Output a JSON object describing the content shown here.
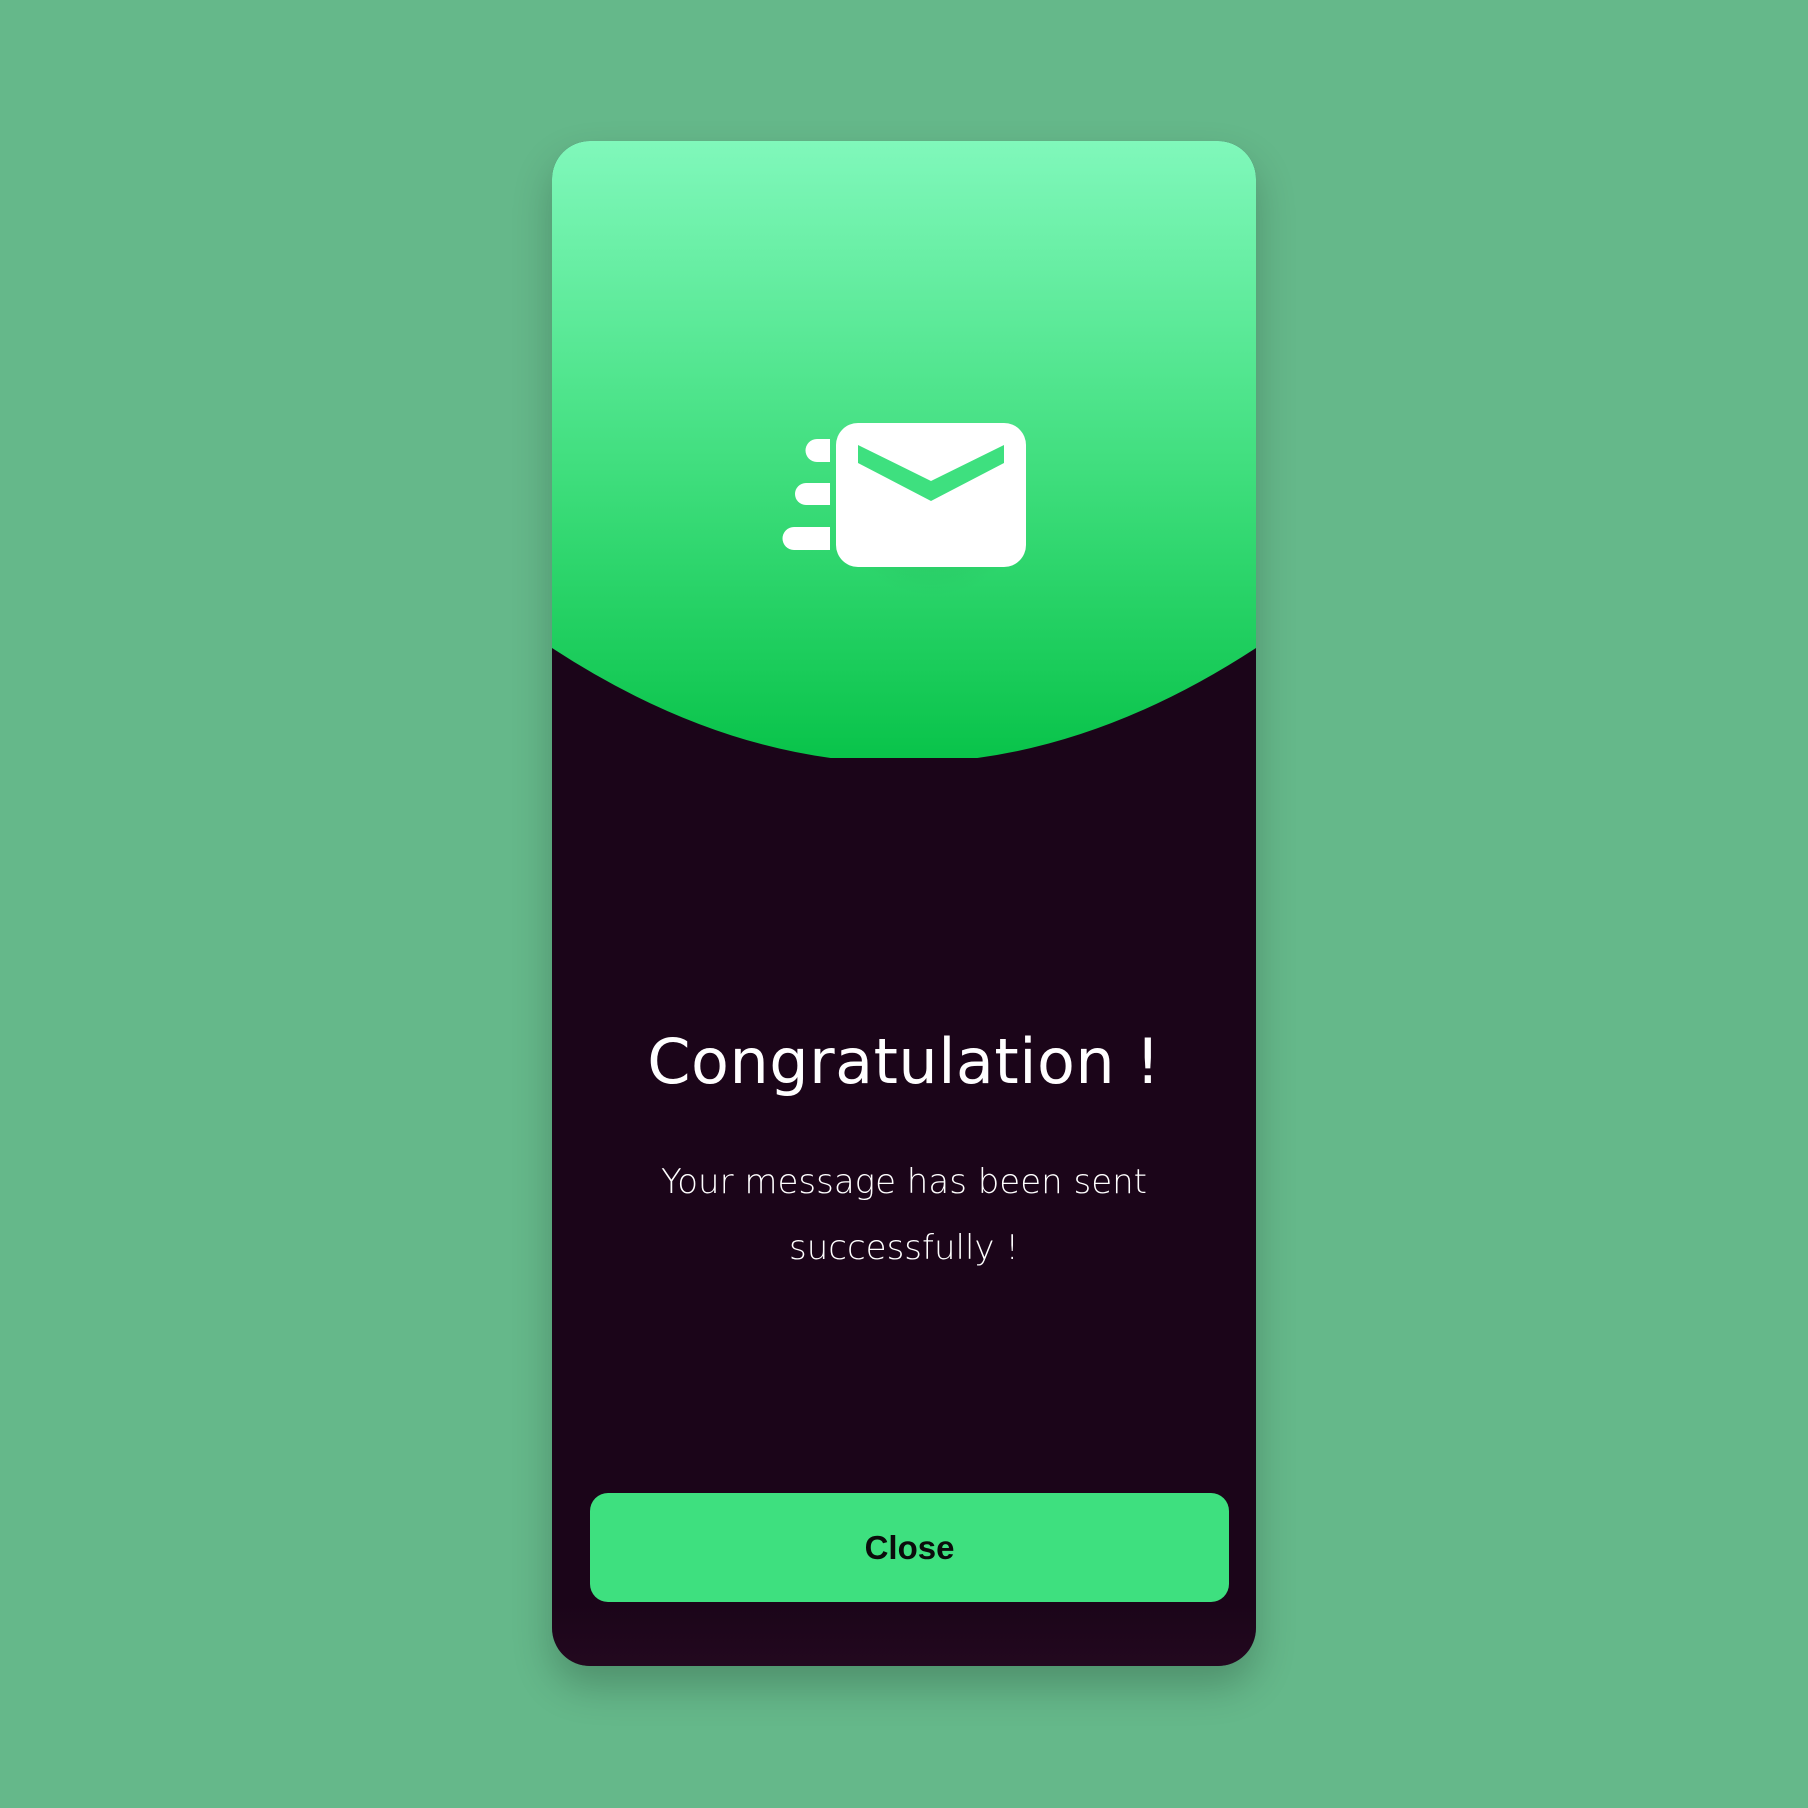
{
  "dialog": {
    "title": "Congratulation !",
    "message": "Your message has been sent successfully !",
    "close_label": "Close"
  },
  "icons": {
    "hero": "sent-mail-icon"
  },
  "colors": {
    "page_background": "#65b88a",
    "card_background": "#1b0519",
    "hero_gradient_top": "#80f8bb",
    "hero_gradient_bottom": "#08c349",
    "button_background": "#3ee07f",
    "text_primary": "#ffffff"
  }
}
